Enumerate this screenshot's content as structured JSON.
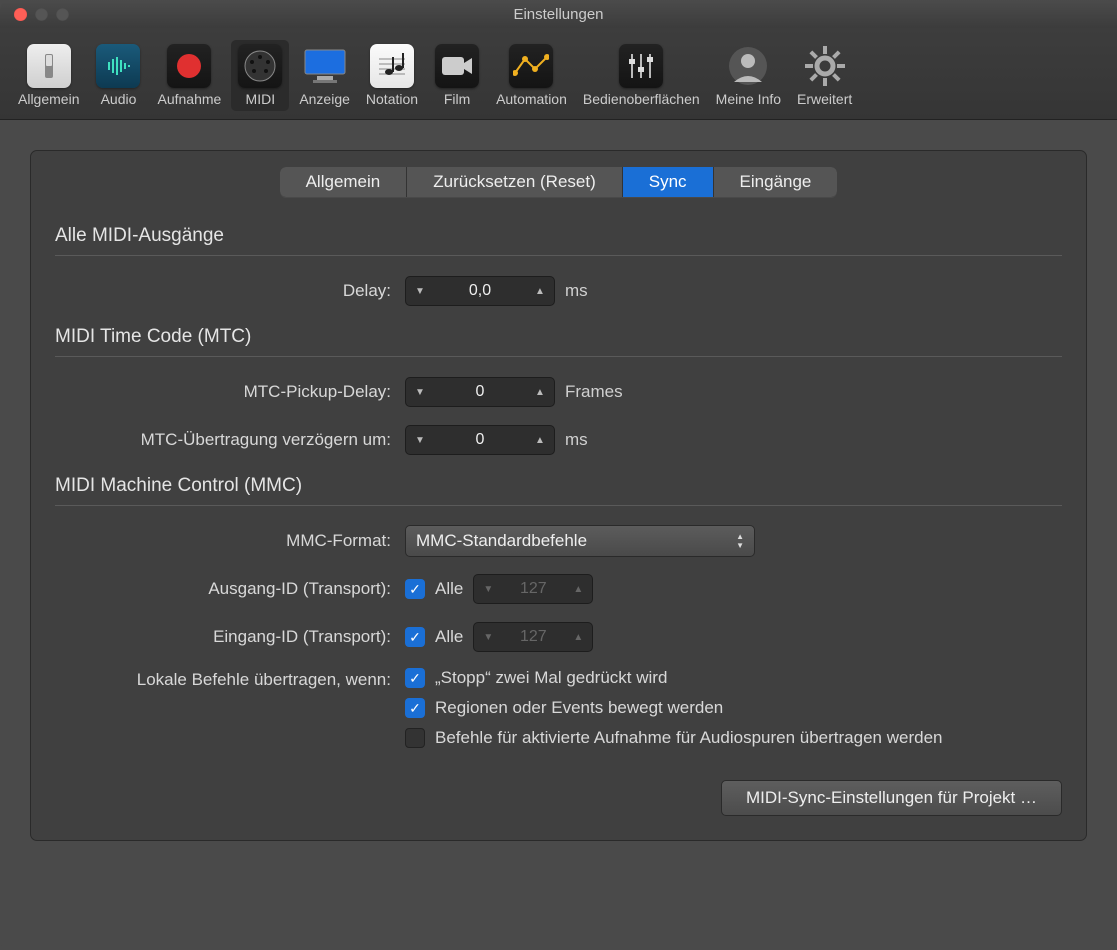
{
  "window": {
    "title": "Einstellungen"
  },
  "toolbar": {
    "items": [
      {
        "id": "allgemein",
        "label": "Allgemein"
      },
      {
        "id": "audio",
        "label": "Audio"
      },
      {
        "id": "aufnahme",
        "label": "Aufnahme"
      },
      {
        "id": "midi",
        "label": "MIDI",
        "selected": true
      },
      {
        "id": "anzeige",
        "label": "Anzeige"
      },
      {
        "id": "notation",
        "label": "Notation"
      },
      {
        "id": "film",
        "label": "Film"
      },
      {
        "id": "automation",
        "label": "Automation"
      },
      {
        "id": "bedienoberflaechen",
        "label": "Bedienoberflächen"
      },
      {
        "id": "meineinfo",
        "label": "Meine Info"
      },
      {
        "id": "erweitert",
        "label": "Erweitert"
      }
    ]
  },
  "tabs": {
    "items": [
      {
        "label": "Allgemein"
      },
      {
        "label": "Zurücksetzen (Reset)"
      },
      {
        "label": "Sync",
        "active": true
      },
      {
        "label": "Eingänge"
      }
    ]
  },
  "sections": {
    "all_outputs": {
      "header": "Alle MIDI-Ausgänge",
      "delay_label": "Delay:",
      "delay_value": "0,0",
      "delay_unit": "ms"
    },
    "mtc": {
      "header": "MIDI Time Code (MTC)",
      "pickup_label": "MTC-Pickup-Delay:",
      "pickup_value": "0",
      "pickup_unit": "Frames",
      "delay_tx_label": "MTC-Übertragung verzögern um:",
      "delay_tx_value": "0",
      "delay_tx_unit": "ms"
    },
    "mmc": {
      "header": "MIDI Machine Control (MMC)",
      "format_label": "MMC-Format:",
      "format_value": "MMC-Standardbefehle",
      "out_id_label": "Ausgang-ID (Transport):",
      "out_id_all": "Alle",
      "out_id_value": "127",
      "in_id_label": "Eingang-ID (Transport):",
      "in_id_all": "Alle",
      "in_id_value": "127",
      "local_label": "Lokale Befehle übertragen, wenn:",
      "local_opts": [
        {
          "label": "„Stopp“ zwei Mal gedrückt wird",
          "checked": true
        },
        {
          "label": "Regionen oder Events bewegt werden",
          "checked": true
        },
        {
          "label": "Befehle für aktivierte Aufnahme für Audiospuren übertragen werden",
          "checked": false
        }
      ],
      "project_btn": "MIDI-Sync-Einstellungen für Projekt …"
    }
  }
}
